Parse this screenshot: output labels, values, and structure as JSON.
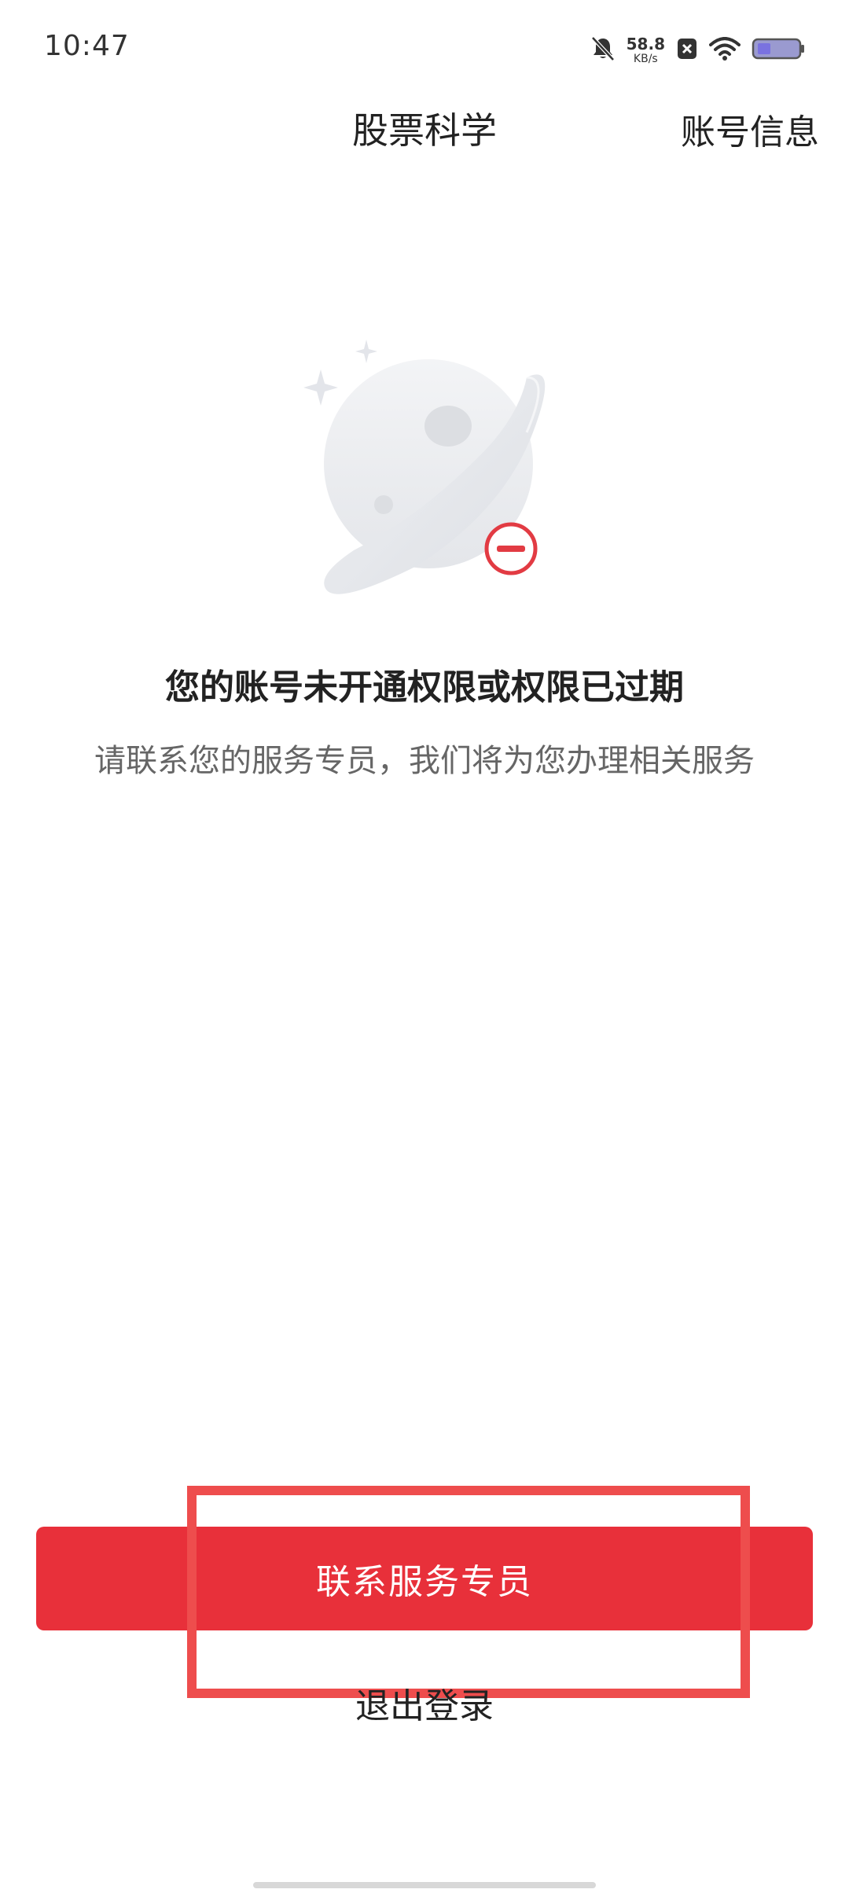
{
  "status_bar": {
    "time": "10:47",
    "net_speed_value": "58.8",
    "net_speed_unit": "KB/s",
    "icons": [
      "bell-off-icon",
      "close-badge-icon",
      "wifi-icon",
      "battery-icon"
    ]
  },
  "nav": {
    "title": "股票科学",
    "right_action": "账号信息"
  },
  "message": {
    "title": "您的账号未开通权限或权限已过期",
    "subtitle": "请联系您的服务专员，我们将为您办理相关服务"
  },
  "actions": {
    "primary_label": "联系服务专员",
    "secondary_label": "退出登录"
  },
  "colors": {
    "accent": "#e8303a",
    "highlight": "#ee4d4d",
    "error_badge": "#e23b43"
  }
}
